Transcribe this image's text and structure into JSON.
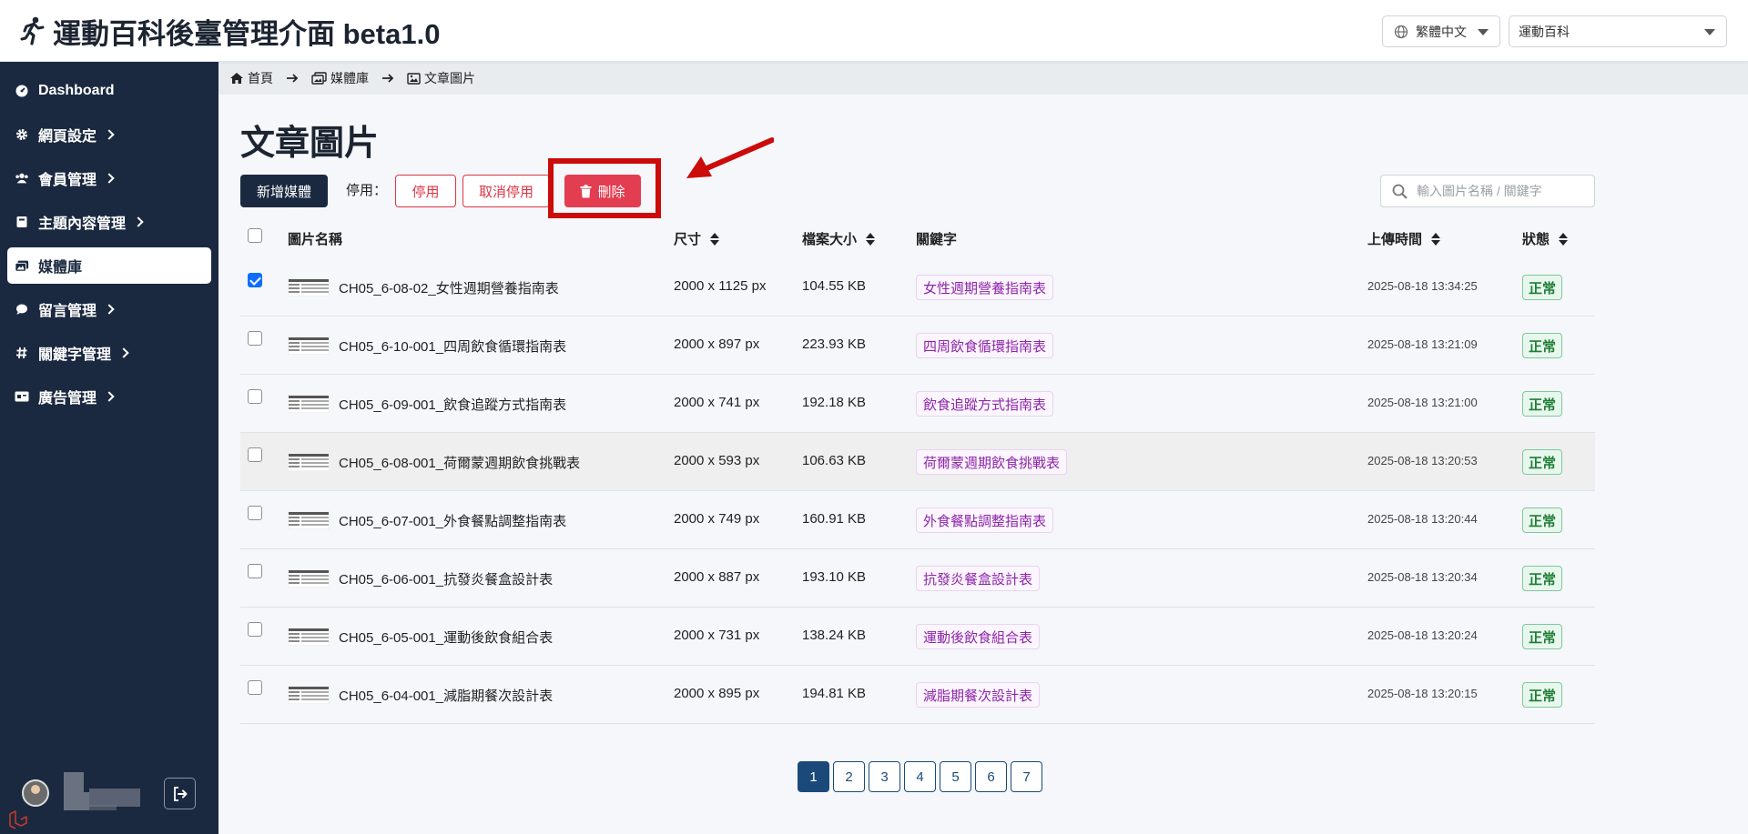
{
  "header": {
    "app_title": "運動百科後臺管理介面 beta1.0",
    "language": "繁體中文",
    "site": "運動百科"
  },
  "sidebar": {
    "items": [
      {
        "label": "Dashboard",
        "icon": "gauge-icon",
        "has_children": false,
        "active": false
      },
      {
        "label": "網頁設定",
        "icon": "gear-icon",
        "has_children": true,
        "active": false
      },
      {
        "label": "會員管理",
        "icon": "users-icon",
        "has_children": true,
        "active": false
      },
      {
        "label": "主題內容管理",
        "icon": "book-icon",
        "has_children": true,
        "active": false
      },
      {
        "label": "媒體庫",
        "icon": "images-icon",
        "has_children": false,
        "active": true
      },
      {
        "label": "留言管理",
        "icon": "comment-icon",
        "has_children": true,
        "active": false
      },
      {
        "label": "關鍵字管理",
        "icon": "hashtag-icon",
        "has_children": true,
        "active": false
      },
      {
        "label": "廣告管理",
        "icon": "ad-icon",
        "has_children": true,
        "active": false
      }
    ]
  },
  "breadcrumb": {
    "home": "首頁",
    "media": "媒體庫",
    "current": "文章圖片"
  },
  "page": {
    "title": "文章圖片",
    "add_button": "新增媒體",
    "disable_label": "停用：",
    "stop_button": "停用",
    "unstop_button": "取消停用",
    "delete_button": "刪除",
    "search_placeholder": "輸入圖片名稱 / 關鍵字"
  },
  "table": {
    "columns": {
      "name": "圖片名稱",
      "size": "尺寸",
      "file_size": "檔案大小",
      "keyword": "關鍵字",
      "upload_time": "上傳時間",
      "status": "狀態"
    },
    "rows": [
      {
        "checked": true,
        "name": "CH05_6-08-02_女性週期營養指南表",
        "size": "2000 x 1125 px",
        "file_size": "104.55 KB",
        "keyword": "女性週期營養指南表",
        "upload_time": "2025-08-18 13:34:25",
        "status": "正常"
      },
      {
        "checked": false,
        "name": "CH05_6-10-001_四周飲食循環指南表",
        "size": "2000 x 897 px",
        "file_size": "223.93 KB",
        "keyword": "四周飲食循環指南表",
        "upload_time": "2025-08-18 13:21:09",
        "status": "正常"
      },
      {
        "checked": false,
        "name": "CH05_6-09-001_飲食追蹤方式指南表",
        "size": "2000 x 741 px",
        "file_size": "192.18 KB",
        "keyword": "飲食追蹤方式指南表",
        "upload_time": "2025-08-18 13:21:00",
        "status": "正常"
      },
      {
        "checked": false,
        "name": "CH05_6-08-001_荷爾蒙週期飲食挑戰表",
        "size": "2000 x 593 px",
        "file_size": "106.63 KB",
        "keyword": "荷爾蒙週期飲食挑戰表",
        "upload_time": "2025-08-18 13:20:53",
        "status": "正常"
      },
      {
        "checked": false,
        "name": "CH05_6-07-001_外食餐點調整指南表",
        "size": "2000 x 749 px",
        "file_size": "160.91 KB",
        "keyword": "外食餐點調整指南表",
        "upload_time": "2025-08-18 13:20:44",
        "status": "正常"
      },
      {
        "checked": false,
        "name": "CH05_6-06-001_抗發炎餐盒設計表",
        "size": "2000 x 887 px",
        "file_size": "193.10 KB",
        "keyword": "抗發炎餐盒設計表",
        "upload_time": "2025-08-18 13:20:34",
        "status": "正常"
      },
      {
        "checked": false,
        "name": "CH05_6-05-001_運動後飲食組合表",
        "size": "2000 x 731 px",
        "file_size": "138.24 KB",
        "keyword": "運動後飲食組合表",
        "upload_time": "2025-08-18 13:20:24",
        "status": "正常"
      },
      {
        "checked": false,
        "name": "CH05_6-04-001_減脂期餐次設計表",
        "size": "2000 x 895 px",
        "file_size": "194.81 KB",
        "keyword": "減脂期餐次設計表",
        "upload_time": "2025-08-18 13:20:15",
        "status": "正常"
      }
    ]
  },
  "pagination": {
    "pages": [
      "1",
      "2",
      "3",
      "4",
      "5",
      "6",
      "7"
    ],
    "current": "1"
  },
  "colors": {
    "sidebar_bg": "#1b2940",
    "delete_red": "#e33d52",
    "annotation_red": "#cc0b0b",
    "keyword_purple": "#8e24aa",
    "status_green": "#1e7e34"
  }
}
